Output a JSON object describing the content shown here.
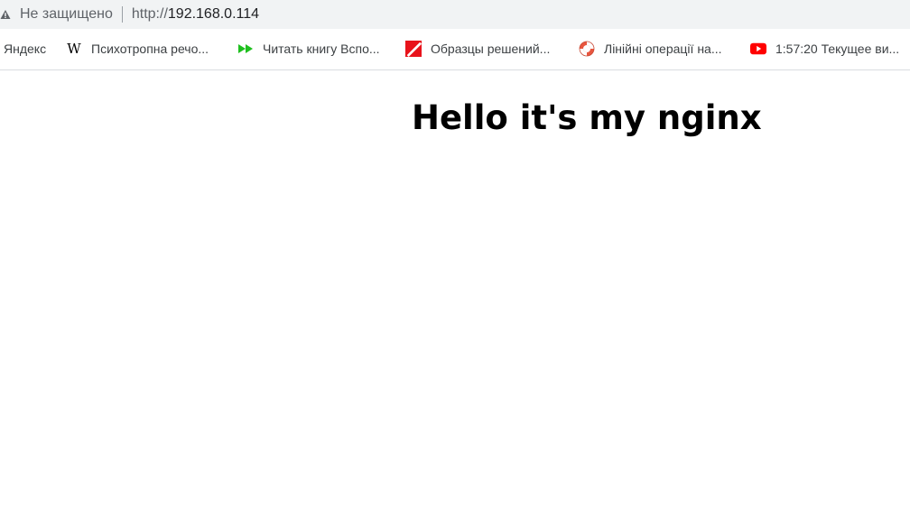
{
  "address_bar": {
    "security_icon": "warning-triangle-icon",
    "security_text": "Не защищено",
    "url_scheme": "http://",
    "url_host": "192.168.0.114"
  },
  "bookmarks": [
    {
      "label": "Яндекс",
      "icon": "none"
    },
    {
      "label": "Психотропна речо...",
      "icon": "wikipedia-icon"
    },
    {
      "label": "Читать книгу Вспо...",
      "icon": "green-fast-forward-icon"
    },
    {
      "label": "Образцы решений...",
      "icon": "red-square-slash-icon"
    },
    {
      "label": "Лінійні операції на...",
      "icon": "lifebuoy-icon"
    },
    {
      "label": "1:57:20 Текущее ви...",
      "icon": "youtube-icon"
    }
  ],
  "page": {
    "heading": "Hello it's my nginx"
  },
  "colors": {
    "toolbar_bg": "#f1f3f4",
    "text_muted": "#5f6368",
    "youtube_red": "#ff0000",
    "ff_green": "#1fbf1f"
  }
}
